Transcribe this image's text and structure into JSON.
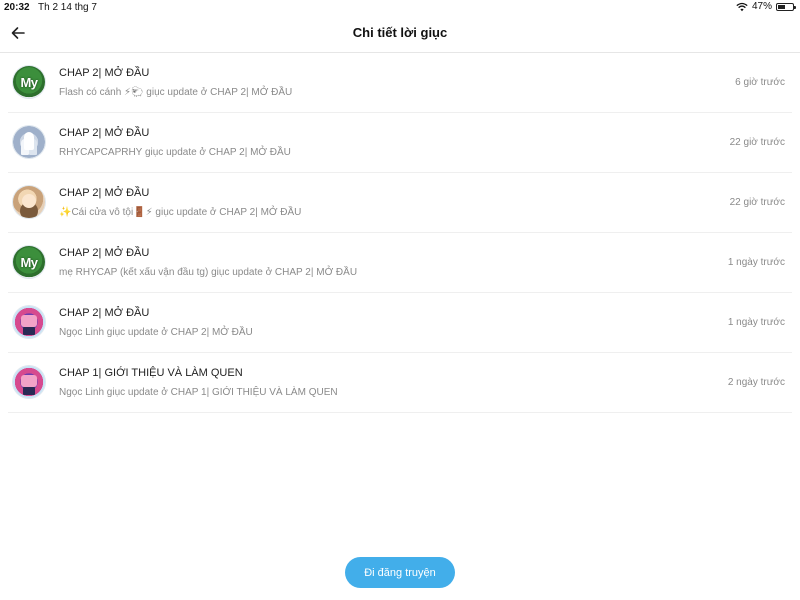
{
  "status_bar": {
    "time": "20:32",
    "date": "Th 2 14 thg 7",
    "battery": "47%",
    "battery_level": 0.47
  },
  "header": {
    "title": "Chi tiết lời giục"
  },
  "notifications": [
    {
      "chapter": "CHAP 2| MỞ ĐẦU",
      "message": "Flash có cánh ⚡🐑 giục update ở CHAP 2| MỞ ĐẦU",
      "time": "6 giờ trước",
      "avatar_text": "My"
    },
    {
      "chapter": "CHAP 2| MỞ ĐẦU",
      "message": "RHYCAPCAPRHY giục update ở CHAP 2| MỞ ĐẦU",
      "time": "22 giờ trước"
    },
    {
      "chapter": "CHAP 2| MỞ ĐẦU",
      "message": "✨Cái cửa vô tội🚪⚡ giục update ở CHAP 2| MỞ ĐẦU",
      "time": "22 giờ trước"
    },
    {
      "chapter": "CHAP 2| MỞ ĐẦU",
      "message": "mẹ RHYCAP (kết xấu vận đầu tg) giục update ở CHAP 2| MỞ ĐẦU",
      "time": "1 ngày trước",
      "avatar_text": "My"
    },
    {
      "chapter": "CHAP 2| MỞ ĐẦU",
      "message": "Ngọc Linh giục update ở CHAP 2| MỞ ĐẦU",
      "time": "1 ngày trước"
    },
    {
      "chapter": "CHAP 1| GIỚI THIỆU VÀ LÀM QUEN",
      "message": "Ngọc Linh giục update ở CHAP 1| GIỚI THIỆU VÀ LÀM QUEN",
      "time": "2 ngày trước"
    }
  ],
  "actions": {
    "primary_button_label": "Đi đăng truyện"
  },
  "colors": {
    "accent": "#42aeea",
    "secondary_text": "#8a8a8a"
  }
}
